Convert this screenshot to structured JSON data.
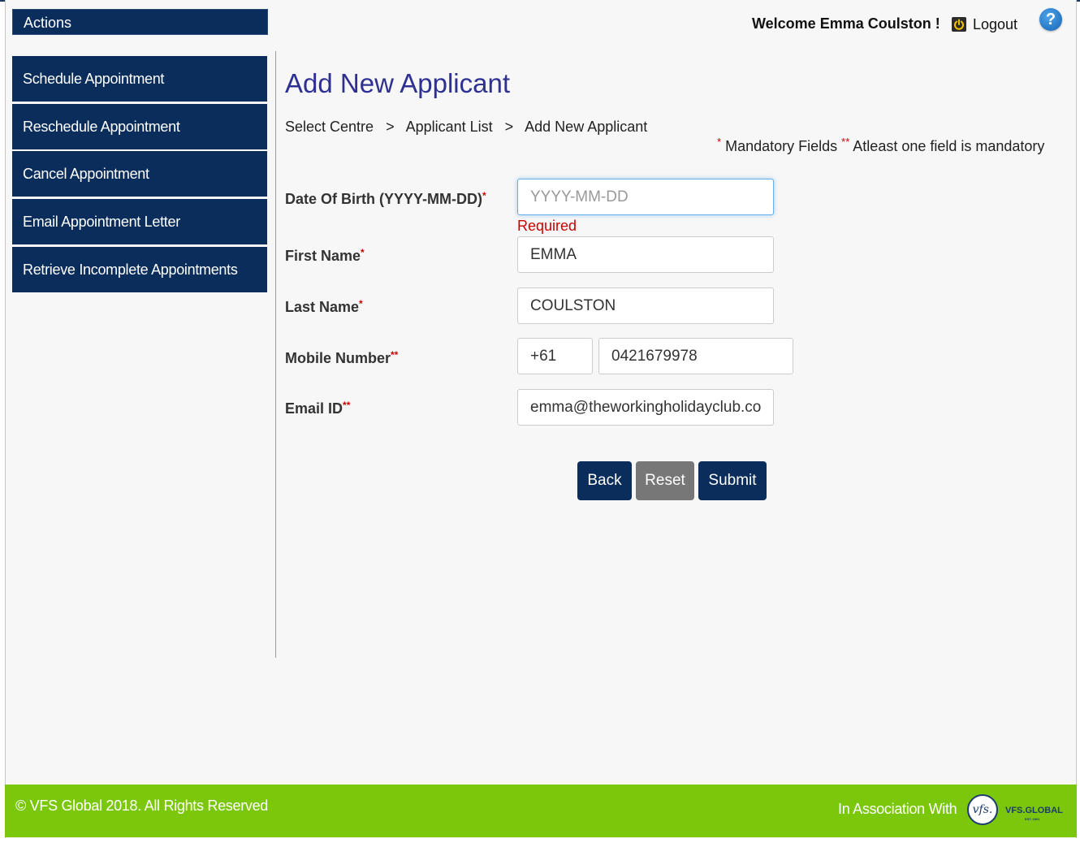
{
  "sidebar": {
    "header": "Actions",
    "items": [
      {
        "label": "Schedule Appointment"
      },
      {
        "label": "Reschedule Appointment"
      },
      {
        "label": "Cancel Appointment"
      },
      {
        "label": "Email Appointment Letter"
      },
      {
        "label": "Retrieve Incomplete Appointments"
      }
    ]
  },
  "header": {
    "welcome": "Welcome Emma Coulston !",
    "logout": "Logout",
    "help": "?"
  },
  "page": {
    "title": "Add New Applicant",
    "breadcrumb": [
      "Select Centre",
      "Applicant List",
      "Add New Applicant"
    ],
    "breadcrumb_separator": ">",
    "legend": {
      "single_star": "*",
      "single_text": "Mandatory Fields",
      "double_star": "**",
      "double_text": "Atleast one field is mandatory"
    }
  },
  "form": {
    "dob": {
      "label": "Date Of Birth (YYYY-MM-DD)",
      "marker": "*",
      "value": "",
      "placeholder": "YYYY-MM-DD",
      "error": "Required"
    },
    "first_name": {
      "label": "First Name",
      "marker": "*",
      "value": "EMMA"
    },
    "last_name": {
      "label": "Last Name",
      "marker": "*",
      "value": "COULSTON"
    },
    "mobile": {
      "label": "Mobile Number",
      "marker": "**",
      "country_code": "+61",
      "number": "0421679978"
    },
    "email": {
      "label": "Email ID",
      "marker": "**",
      "value": "emma@theworkingholidayclub.com"
    }
  },
  "buttons": {
    "back": "Back",
    "reset": "Reset",
    "submit": "Submit"
  },
  "footer": {
    "copyright": "© VFS Global 2018. All Rights Reserved",
    "association": "In Association With",
    "logo_mark": "vfs.",
    "logo_word": "VFS.GLOBAL",
    "logo_est": "EST. 2001"
  },
  "colors": {
    "nav_bg": "#0b2d5b",
    "title": "#2e3192",
    "footer_bg": "#7ac70c",
    "error": "#cc0000",
    "reset_btn": "#777777"
  }
}
